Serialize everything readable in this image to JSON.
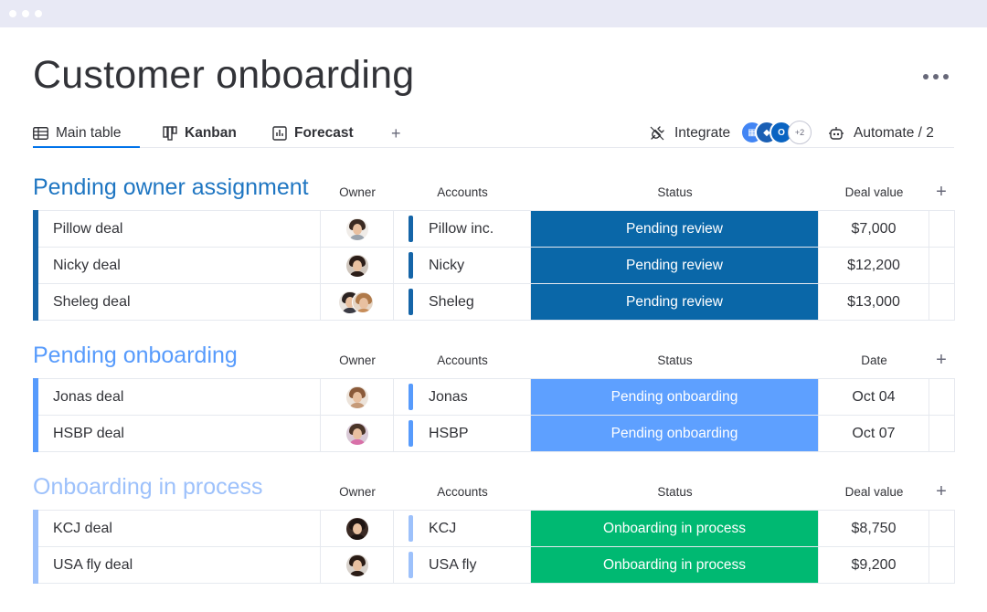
{
  "page": {
    "title": "Customer onboarding",
    "more_icon": "more-horizontal-icon"
  },
  "tabs": [
    {
      "label": "Main table",
      "icon": "table-icon",
      "active": true
    },
    {
      "label": "Kanban",
      "icon": "kanban-icon",
      "active": false
    },
    {
      "label": "Forecast",
      "icon": "chart-icon",
      "active": false
    }
  ],
  "toolbar": {
    "add_tab": "+",
    "integrate_label": "Integrate",
    "integrations_more": "+2",
    "automate_label": "Automate / 2"
  },
  "colors": {
    "group1": "#1f76c2",
    "group1_bar": "#1565a8",
    "group2": "#579bfc",
    "group3": "#9dc1fb",
    "status_review": "#0a67a8",
    "status_onboarding": "#5ea0ff",
    "status_process": "#00b972",
    "active_tab": "#0073ea"
  },
  "groups": [
    {
      "title": "Pending owner assignment",
      "columns": {
        "owner": "Owner",
        "accounts": "Accounts",
        "status": "Status",
        "value": "Deal value",
        "add": "+"
      },
      "rows": [
        {
          "name": "Pillow deal",
          "account": "Pillow inc.",
          "status": "Pending review",
          "value": "$7,000"
        },
        {
          "name": "Nicky deal",
          "account": "Nicky",
          "status": "Pending review",
          "value": "$12,200"
        },
        {
          "name": "Sheleg deal",
          "account": "Sheleg",
          "status": "Pending review",
          "value": "$13,000"
        }
      ]
    },
    {
      "title": "Pending onboarding",
      "columns": {
        "owner": "Owner",
        "accounts": "Accounts",
        "status": "Status",
        "value": "Date",
        "add": "+"
      },
      "rows": [
        {
          "name": "Jonas deal",
          "account": "Jonas",
          "status": "Pending onboarding",
          "value": "Oct 04"
        },
        {
          "name": "HSBP deal",
          "account": "HSBP",
          "status": "Pending onboarding",
          "value": "Oct 07"
        }
      ]
    },
    {
      "title": "Onboarding in process",
      "columns": {
        "owner": "Owner",
        "accounts": "Accounts",
        "status": "Status",
        "value": "Deal value",
        "add": "+"
      },
      "rows": [
        {
          "name": "KCJ deal",
          "account": "KCJ",
          "status": "Onboarding in process",
          "value": "$8,750"
        },
        {
          "name": "USA fly deal",
          "account": "USA fly",
          "status": "Onboarding in process",
          "value": "$9,200"
        }
      ]
    }
  ]
}
